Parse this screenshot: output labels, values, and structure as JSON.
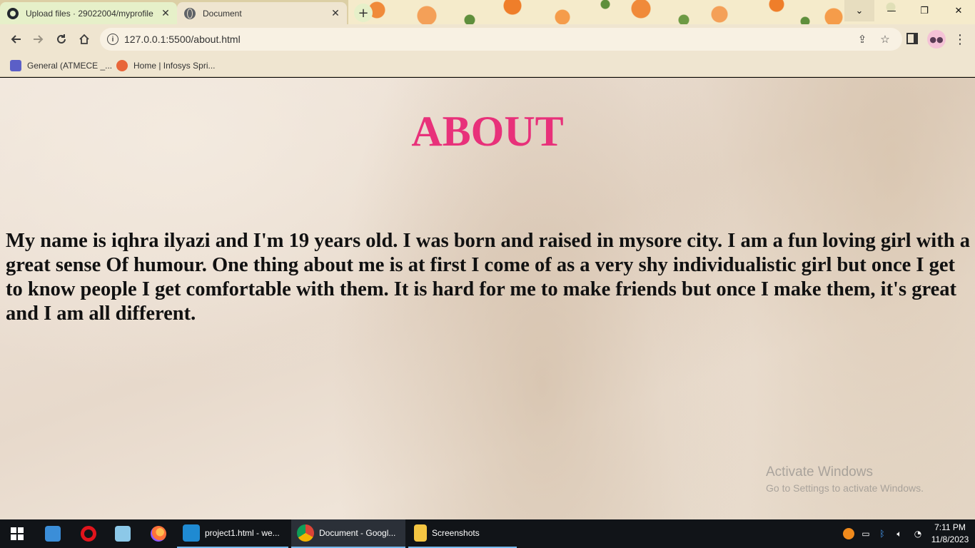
{
  "browser": {
    "tabs": [
      {
        "title": "Upload files · 29022004/myprofile",
        "active": false,
        "icon": "github-icon"
      },
      {
        "title": "Document",
        "active": true,
        "icon": "globe-icon"
      }
    ],
    "new_tab_label": "+",
    "url": "127.0.0.1:5500/about.html",
    "bookmarks": [
      {
        "label": "General (ATMECE _...",
        "icon": "teams-icon"
      },
      {
        "label": "Home | Infosys Spri...",
        "icon": "infosys-icon"
      }
    ],
    "window_controls": {
      "dropdown": "⌄",
      "minimize": "—",
      "maximize": "❐",
      "close": "✕"
    }
  },
  "page": {
    "title": "ABOUT",
    "body": "My name is iqhra ilyazi and I'm 19 years old. I was born and raised in mysore city. I am a fun loving girl with a great sense Of humour. One thing about me is at first I come of as a very shy individualistic girl but once I get to know people I get comfortable with them. It is hard for me to make friends but once I make them, it's great and I am all different.",
    "title_color": "#e8317a"
  },
  "watermark": {
    "line1": "Activate Windows",
    "line2": "Go to Settings to activate Windows."
  },
  "taskbar": {
    "apps": [
      {
        "label": "project1.html - we...",
        "icon": "vscode-icon",
        "state": "open"
      },
      {
        "label": "Document - Googl...",
        "icon": "chrome-icon",
        "state": "active"
      },
      {
        "label": "Screenshots",
        "icon": "folder-icon",
        "state": "open"
      }
    ],
    "pinned": [
      "file-explorer-icon",
      "opera-icon",
      "notepad-icon",
      "firefox-icon"
    ],
    "clock": {
      "time": "7:11 PM",
      "date": "11/8/2023"
    }
  }
}
